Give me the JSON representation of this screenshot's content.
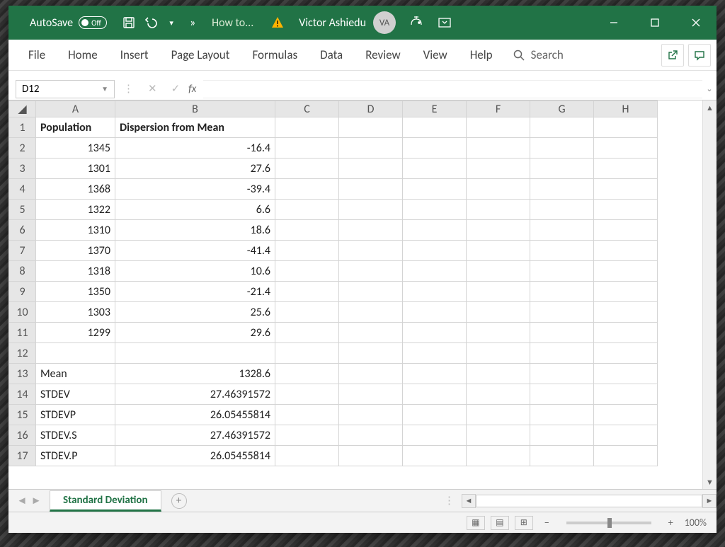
{
  "titlebar": {
    "autosave_label": "AutoSave",
    "autosave_state": "Off",
    "doc_title": "How to...",
    "username": "Victor Ashiedu",
    "avatar": "VA"
  },
  "ribbon": {
    "tabs": [
      "File",
      "Home",
      "Insert",
      "Page Layout",
      "Formulas",
      "Data",
      "Review",
      "View",
      "Help"
    ],
    "search_label": "Search"
  },
  "formula_bar": {
    "name_box": "D12",
    "formula": ""
  },
  "columns": [
    "A",
    "B",
    "C",
    "D",
    "E",
    "F",
    "G",
    "H"
  ],
  "headers": {
    "A": "Population",
    "B": "Dispersion from Mean"
  },
  "rows": [
    {
      "r": 1,
      "A": "Population",
      "B": "Dispersion from Mean",
      "hdr": true
    },
    {
      "r": 2,
      "A": "1345",
      "B": "-16.4"
    },
    {
      "r": 3,
      "A": "1301",
      "B": "27.6"
    },
    {
      "r": 4,
      "A": "1368",
      "B": "-39.4"
    },
    {
      "r": 5,
      "A": "1322",
      "B": "6.6"
    },
    {
      "r": 6,
      "A": "1310",
      "B": "18.6"
    },
    {
      "r": 7,
      "A": "1370",
      "B": "-41.4"
    },
    {
      "r": 8,
      "A": "1318",
      "B": "10.6"
    },
    {
      "r": 9,
      "A": "1350",
      "B": "-21.4"
    },
    {
      "r": 10,
      "A": "1303",
      "B": "25.6"
    },
    {
      "r": 11,
      "A": "1299",
      "B": "29.6"
    },
    {
      "r": 12,
      "A": "",
      "B": ""
    },
    {
      "r": 13,
      "A": "Mean",
      "B": "1328.6",
      "txtA": true
    },
    {
      "r": 14,
      "A": "STDEV",
      "B": "27.46391572",
      "txtA": true
    },
    {
      "r": 15,
      "A": "STDEVP",
      "B": "26.05455814",
      "txtA": true
    },
    {
      "r": 16,
      "A": "STDEV.S",
      "B": "27.46391572",
      "txtA": true
    },
    {
      "r": 17,
      "A": "STDEV.P",
      "B": "26.05455814",
      "txtA": true
    }
  ],
  "sheet_tab": "Standard Deviation",
  "zoom": "100%",
  "chart_data": {
    "type": "table",
    "title": "Standard Deviation",
    "population": [
      1345,
      1301,
      1368,
      1322,
      1310,
      1370,
      1318,
      1350,
      1303,
      1299
    ],
    "dispersion_from_mean": [
      -16.4,
      27.6,
      -39.4,
      6.6,
      18.6,
      -41.4,
      10.6,
      -21.4,
      25.6,
      29.6
    ],
    "stats": {
      "Mean": 1328.6,
      "STDEV": 27.46391572,
      "STDEVP": 26.05455814,
      "STDEV.S": 27.46391572,
      "STDEV.P": 26.05455814
    }
  }
}
